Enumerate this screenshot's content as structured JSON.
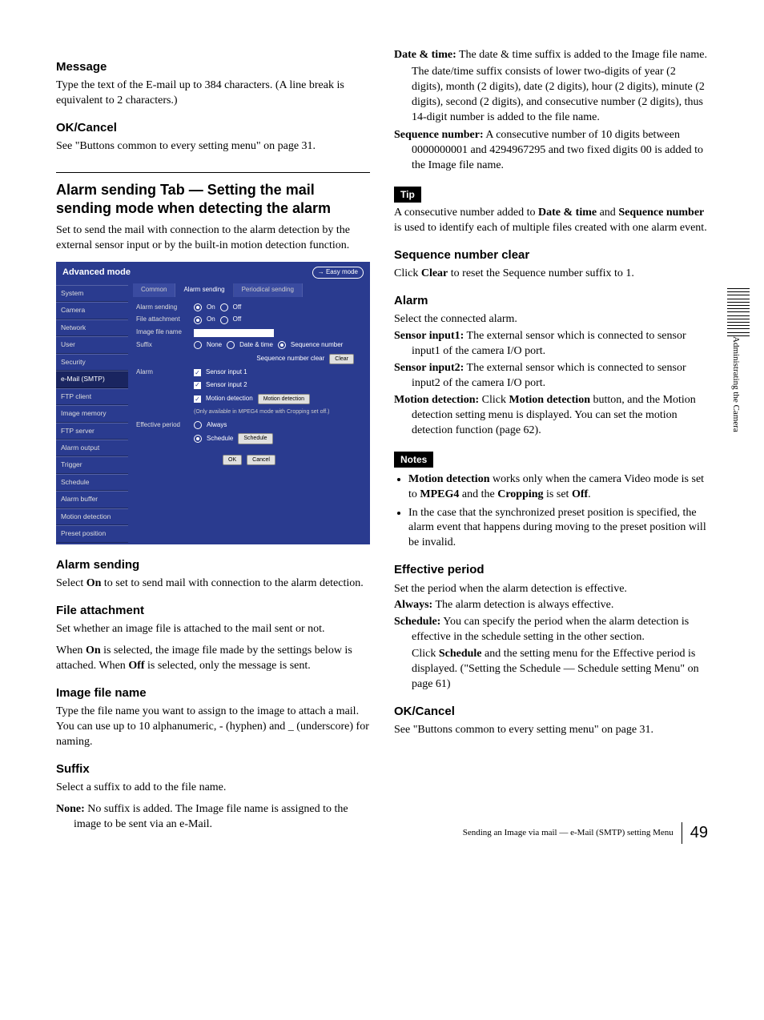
{
  "left": {
    "message_h": "Message",
    "message_p": "Type the text of the E-mail up to 384 characters. (A line break is equivalent to 2 characters.)",
    "okcancel_h": "OK/Cancel",
    "okcancel_p": "See \"Buttons common to every setting menu\" on page 31.",
    "alarm_tab_h": "Alarm sending Tab — Setting the mail sending mode when detecting the alarm",
    "alarm_tab_p": "Set to send the mail with connection to the alarm detection by the external sensor input or by the built-in motion detection function.",
    "alarm_sending_h": "Alarm sending",
    "alarm_sending_p": "Select On to set to send mail with connection to the alarm detection.",
    "alarm_sending_p_pre": "Select ",
    "alarm_sending_p_bold": "On",
    "alarm_sending_p_post": " to set to send mail with connection to the alarm detection.",
    "file_att_h": "File attachment",
    "file_att_p1": "Set whether an image file is attached to the mail sent or not.",
    "file_att_p2_a": "When ",
    "file_att_p2_b": "On",
    "file_att_p2_c": " is selected, the image file made by the settings below is attached. When ",
    "file_att_p2_d": "Off",
    "file_att_p2_e": " is selected, only the message is sent.",
    "img_name_h": "Image file name",
    "img_name_p": "Type the file name you want to assign to the image to attach a mail.  You can use up to 10 alphanumeric, - (hyphen) and _ (underscore) for naming.",
    "suffix_h": "Suffix",
    "suffix_p": "Select a suffix to add to the file name.",
    "suffix_none_l": "None:",
    "suffix_none_t": " No suffix is added.  The Image file name is assigned to the image to be sent via an e-Mail."
  },
  "right": {
    "dt_l": "Date & time:",
    "dt_t": " The date & time suffix is added to the Image file name.",
    "dt_p2": "The date/time suffix consists of lower two-digits of year (2 digits), month (2 digits), date (2 digits), hour (2 digits), minute (2 digits), second (2 digits), and consecutive number (2 digits), thus 14-digit number is added to the file name.",
    "seq_l": "Sequence number:",
    "seq_t": " A consecutive number of 10 digits between 0000000001 and 4294967295 and two fixed digits 00 is added to the Image file name.",
    "tip_label": "Tip",
    "tip_a": "A consecutive number added to ",
    "tip_b": "Date & time",
    "tip_c": " and ",
    "tip_d": "Sequence number",
    "tip_e": " is used to identify each of multiple files created with one alarm event.",
    "seqclear_h": "Sequence number clear",
    "seqclear_a": "Click ",
    "seqclear_b": "Clear",
    "seqclear_c": " to reset the Sequence number suffix to 1.",
    "alarm_h": "Alarm",
    "alarm_p": "Select the connected alarm.",
    "si1_l": "Sensor input1:",
    "si1_t": " The external sensor which is connected to sensor input1 of the camera I/O port.",
    "si2_l": "Sensor input2:",
    "si2_t": " The external sensor which is connected to sensor input2 of the camera I/O port.",
    "md_l": "Motion detection:",
    "md_a": " Click ",
    "md_b": "Motion detection",
    "md_c": " button, and the Motion detection setting menu is displayed. You can set the motion detection function (page 62).",
    "notes_label": "Notes",
    "note1_a": "Motion detection",
    "note1_b": " works only when the camera Video mode is set to ",
    "note1_c": "MPEG4",
    "note1_d": " and the ",
    "note1_e": "Cropping",
    "note1_f": " is set ",
    "note1_g": "Off",
    "note1_h": ".",
    "note2": "In the case that the synchronized preset position is specified, the alarm event that happens during moving to the preset position will be invalid.",
    "eff_h": "Effective period",
    "eff_p": "Set the period when the alarm detection is effective.",
    "always_l": "Always:",
    "always_t": " The alarm detection is always effective.",
    "sched_l": "Schedule:",
    "sched_t": " You can specify the period when the alarm detection is effective in the schedule setting in the other section.",
    "sched_p2_a": "Click ",
    "sched_p2_b": "Schedule",
    "sched_p2_c": " and the setting menu for the Effective period is displayed. (\"Setting the Schedule — Schedule setting Menu\" on page 61)",
    "okcancel2_h": "OK/Cancel",
    "okcancel2_p": "See \"Buttons common to every setting menu\" on page 31."
  },
  "screenshot": {
    "mode_title": "Advanced mode",
    "easy_mode": "Easy mode",
    "sidebar": [
      "System",
      "Camera",
      "Network",
      "User",
      "Security",
      "e-Mail (SMTP)",
      "FTP client",
      "Image memory",
      "FTP server",
      "Alarm output",
      "Trigger",
      "Schedule",
      "Alarm buffer",
      "Motion detection",
      "Preset position"
    ],
    "active_sidebar_index": 5,
    "tabs": [
      "Common",
      "Alarm sending",
      "Periodical sending"
    ],
    "active_tab_index": 1,
    "rows": {
      "alarm_sending": "Alarm sending",
      "on": "On",
      "off": "Off",
      "file_attachment": "File attachment",
      "image_file_name": "Image file name",
      "suffix": "Suffix",
      "none": "None",
      "date_time": "Date & time",
      "sequence_number": "Sequence number",
      "seq_clear_label": "Sequence number clear",
      "clear_btn": "Clear",
      "alarm": "Alarm",
      "sensor1": "Sensor input 1",
      "sensor2": "Sensor input 2",
      "motion_detection": "Motion detection",
      "md_btn": "Motion detection",
      "md_note": "(Only available in MPEG4 mode with Cropping set off.)",
      "effective_period": "Effective period",
      "always": "Always",
      "schedule": "Schedule",
      "schedule_btn": "Schedule",
      "ok": "OK",
      "cancel": "Cancel"
    }
  },
  "side_text": "Administrating the Camera",
  "footer": {
    "text": "Sending an Image via mail — e-Mail (SMTP) setting Menu",
    "page": "49"
  }
}
